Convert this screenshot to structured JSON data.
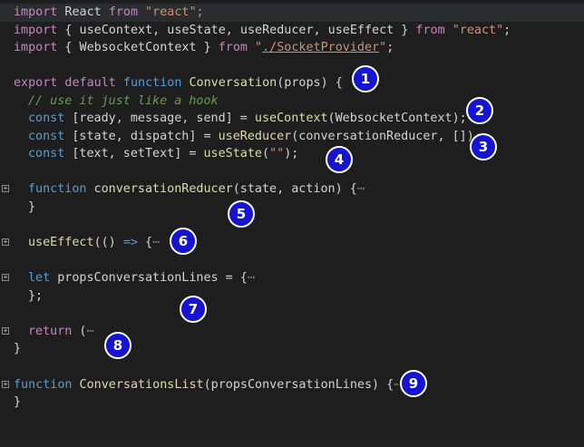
{
  "code": {
    "l1": {
      "kw": "import",
      "name": " React ",
      "from": "from",
      "str": " \"react\";"
    },
    "l2": {
      "kw": "import",
      "a": " { useContext, useState, useReducer, useEffect } ",
      "from": "from",
      "str": " \"react\"",
      "end": ";"
    },
    "l3": {
      "kw": "import",
      "a": " { WebsocketContext } ",
      "from": "from",
      "str1": " \"",
      "path": "./SocketProvider",
      "str2": "\"",
      "end": ";"
    },
    "l5": {
      "kw1": "export",
      "kw2": " default",
      "kw3": " function",
      "fn": " Conversation",
      "args": "(props) ",
      "brace": "{"
    },
    "l6": {
      "comment": "// use it just like a hook"
    },
    "l7": {
      "kw": "const",
      "a": " [ready, message, send] = ",
      "fn": "useContext",
      "b": "(WebsocketContext);"
    },
    "l8": {
      "kw": "const",
      "a": " [state, dispatch] = ",
      "fn": "useReducer",
      "b": "(conversationReducer, []);"
    },
    "l9": {
      "kw": "const",
      "a": " [text, setText] = ",
      "fn": "useState",
      "b": "(",
      "s": "\"\"",
      "c": ");"
    },
    "l11": {
      "kw": "function",
      "fn": " conversationReducer",
      "a": "(state, action) ",
      "brace": "{",
      "dots": "⋯"
    },
    "l12": {
      "a": "}"
    },
    "l14": {
      "fn": "useEffect",
      "a": "(() ",
      "arrow": "=>",
      "b": " {",
      "dots": "⋯"
    },
    "l16": {
      "kw": "let",
      "a": " propsConversationLines = ",
      "b": "{",
      "dots": "⋯"
    },
    "l17": {
      "a": "};"
    },
    "l19": {
      "kw": "return",
      "a": " (",
      "dots": "⋯"
    },
    "l20": {
      "a": "}"
    },
    "l22": {
      "kw": "function",
      "fn": " ConversationsList",
      "a": "(propsConversationLines) ",
      "b": "{",
      "dots": "⋯"
    },
    "l23": {
      "a": "}"
    }
  },
  "fold_glyph": "+",
  "badges": [
    "1",
    "2",
    "3",
    "4",
    "5",
    "6",
    "7",
    "8",
    "9"
  ],
  "colors": {
    "background": "#1e1e1e",
    "badge": "#1414d2",
    "keyword": "#569cd6",
    "control": "#c586c0",
    "function": "#dcdcaa",
    "string": "#ce9178",
    "comment": "#6a9955"
  }
}
